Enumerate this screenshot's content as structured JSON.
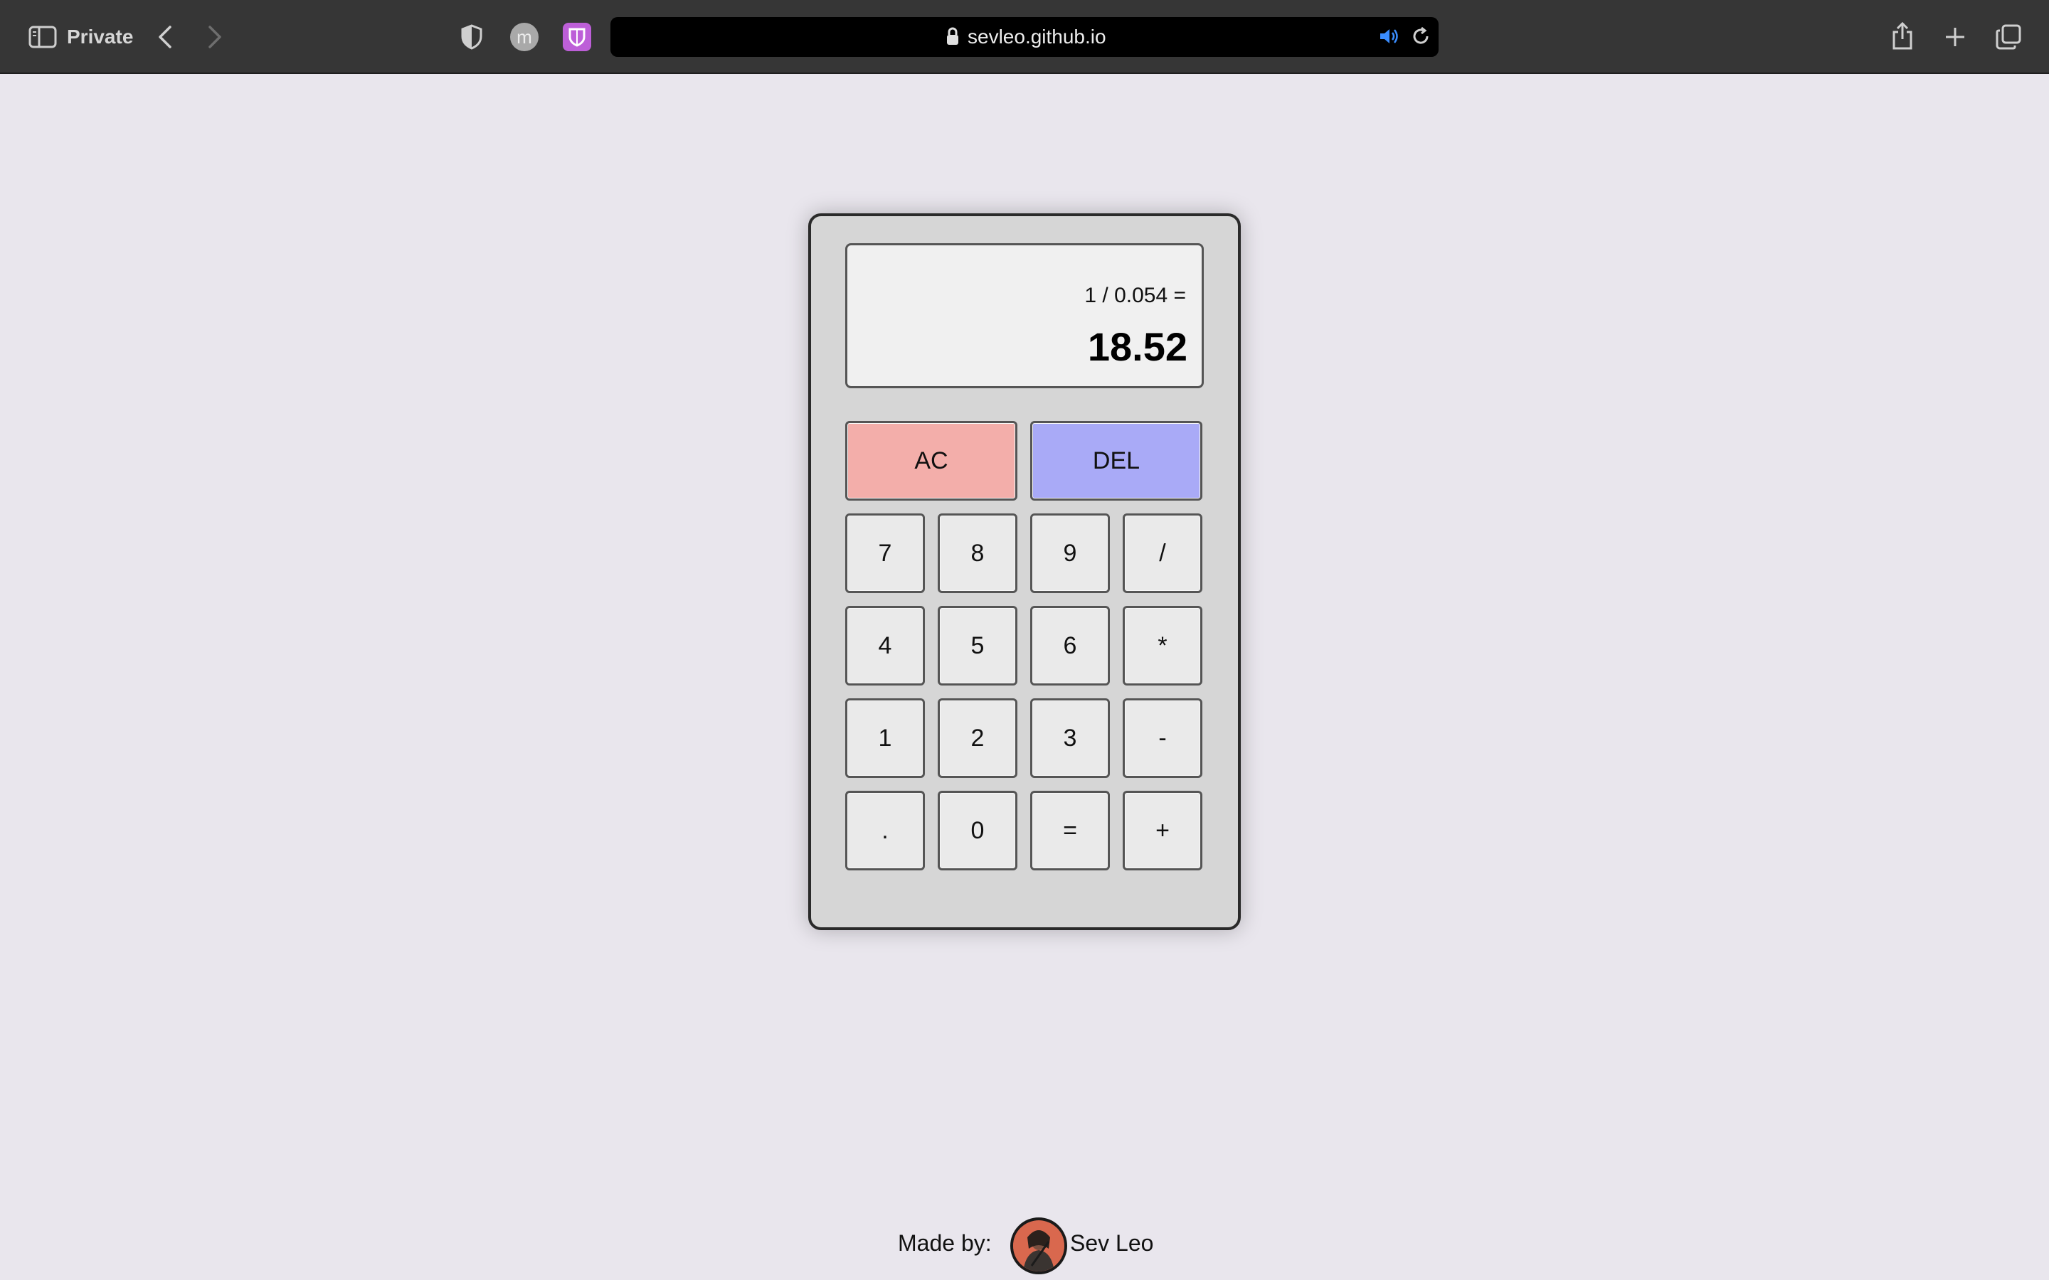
{
  "browser": {
    "mode_label": "Private",
    "profile_initial": "m",
    "url": "sevleo.github.io"
  },
  "calculator": {
    "previous_operand": "1 / 0.054 =",
    "current_operand": "18.52",
    "keys": {
      "ac": "AC",
      "del": "DEL",
      "k7": "7",
      "k8": "8",
      "k9": "9",
      "divide": "/",
      "k4": "4",
      "k5": "5",
      "k6": "6",
      "multiply": "*",
      "k1": "1",
      "k2": "2",
      "k3": "3",
      "subtract": "-",
      "dot": ".",
      "k0": "0",
      "equals": "=",
      "add": "+"
    },
    "colors": {
      "ac": "#f3aeaa",
      "del": "#a9aaf7",
      "key": "#eaeaea",
      "body": "#d6d6d6"
    }
  },
  "footer": {
    "label": "Made by:",
    "author": "Sev Leo"
  }
}
